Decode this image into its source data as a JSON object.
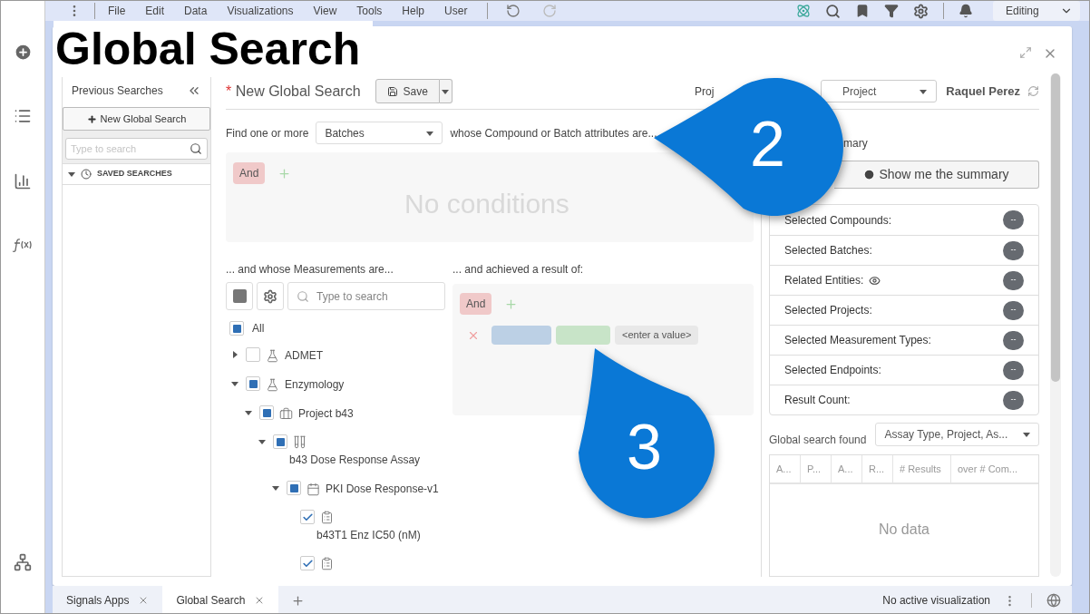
{
  "menu_bar": {
    "items": [
      "File",
      "Edit",
      "Data",
      "Visualizations",
      "View",
      "Tools",
      "Help",
      "User"
    ],
    "mode": "Editing"
  },
  "overlay_title": "Global Search",
  "sidebar": {
    "title": "Previous Searches",
    "new_button": "New Global Search",
    "search_placeholder": "Type to search",
    "saved_searches": {
      "label": "SAVED SEARCHES",
      "expanded": true
    }
  },
  "search": {
    "required_mark": "*",
    "title": "New Global Search",
    "save_button": "Save",
    "project_label": "Proj",
    "project_select": "Project",
    "user": "Raquel Perez",
    "find_label": "Find one or more",
    "entity_select": "Batches",
    "attributes_label": "whose Compound or Batch attributes are...",
    "attribute_conditions": {
      "operator": "And",
      "empty_text": "No conditions"
    },
    "measurements": {
      "label": "... and whose Measurements are...",
      "search_placeholder": "Type to search",
      "all": {
        "label": "All",
        "checked": false,
        "partial": true
      },
      "tree": [
        {
          "label": "ADMET",
          "kind": "category",
          "checked": false,
          "partial": false,
          "expanded": false
        },
        {
          "label": "Enzymology",
          "kind": "category",
          "checked": false,
          "partial": true,
          "expanded": true,
          "children": [
            {
              "label": "Project b43",
              "kind": "project",
              "checked": false,
              "partial": true,
              "expanded": true,
              "children": [
                {
                  "label": "b43 Dose Response Assay",
                  "kind": "assay",
                  "checked": false,
                  "partial": true,
                  "expanded": true,
                  "children": [
                    {
                      "label": "PKI Dose Response-v1",
                      "kind": "protocol",
                      "checked": false,
                      "partial": true,
                      "expanded": true,
                      "children": [
                        {
                          "label": "b43T1 Enz IC50 (nM)",
                          "kind": "endpoint",
                          "checked": true
                        },
                        {
                          "kind": "endpoint",
                          "checked": true
                        }
                      ]
                    }
                  ]
                }
              ]
            }
          ]
        }
      ]
    },
    "results": {
      "label": "... and achieved a result of:",
      "operator": "And",
      "value_placeholder": "<enter a value>"
    }
  },
  "summary": {
    "heading": "mary",
    "button": "Show me the summary",
    "rows": [
      {
        "label": "Selected Compounds:",
        "value": "--",
        "eye": false
      },
      {
        "label": "Selected Batches:",
        "value": "--",
        "eye": false
      },
      {
        "label": "Related Entities:",
        "value": "--",
        "eye": true
      },
      {
        "label": "Selected Projects:",
        "value": "--",
        "eye": false
      },
      {
        "label": "Selected Measurement Types:",
        "value": "--",
        "eye": false
      },
      {
        "label": "Selected Endpoints:",
        "value": "--",
        "eye": false
      },
      {
        "label": "Result Count:",
        "value": "--",
        "eye": false
      }
    ],
    "found_label": "Global search found",
    "grouping_select": "Assay Type, Project, As...",
    "columns": [
      "A...",
      "P...",
      "A...",
      "R...",
      "# Results",
      "over # Com..."
    ],
    "empty_text": "No data"
  },
  "bottom_tabs": [
    {
      "label": "Signals Apps",
      "selected": false
    },
    {
      "label": "Global Search",
      "selected": true
    }
  ],
  "status": "No active visualization",
  "callouts": [
    {
      "number": "2"
    },
    {
      "number": "3"
    }
  ]
}
